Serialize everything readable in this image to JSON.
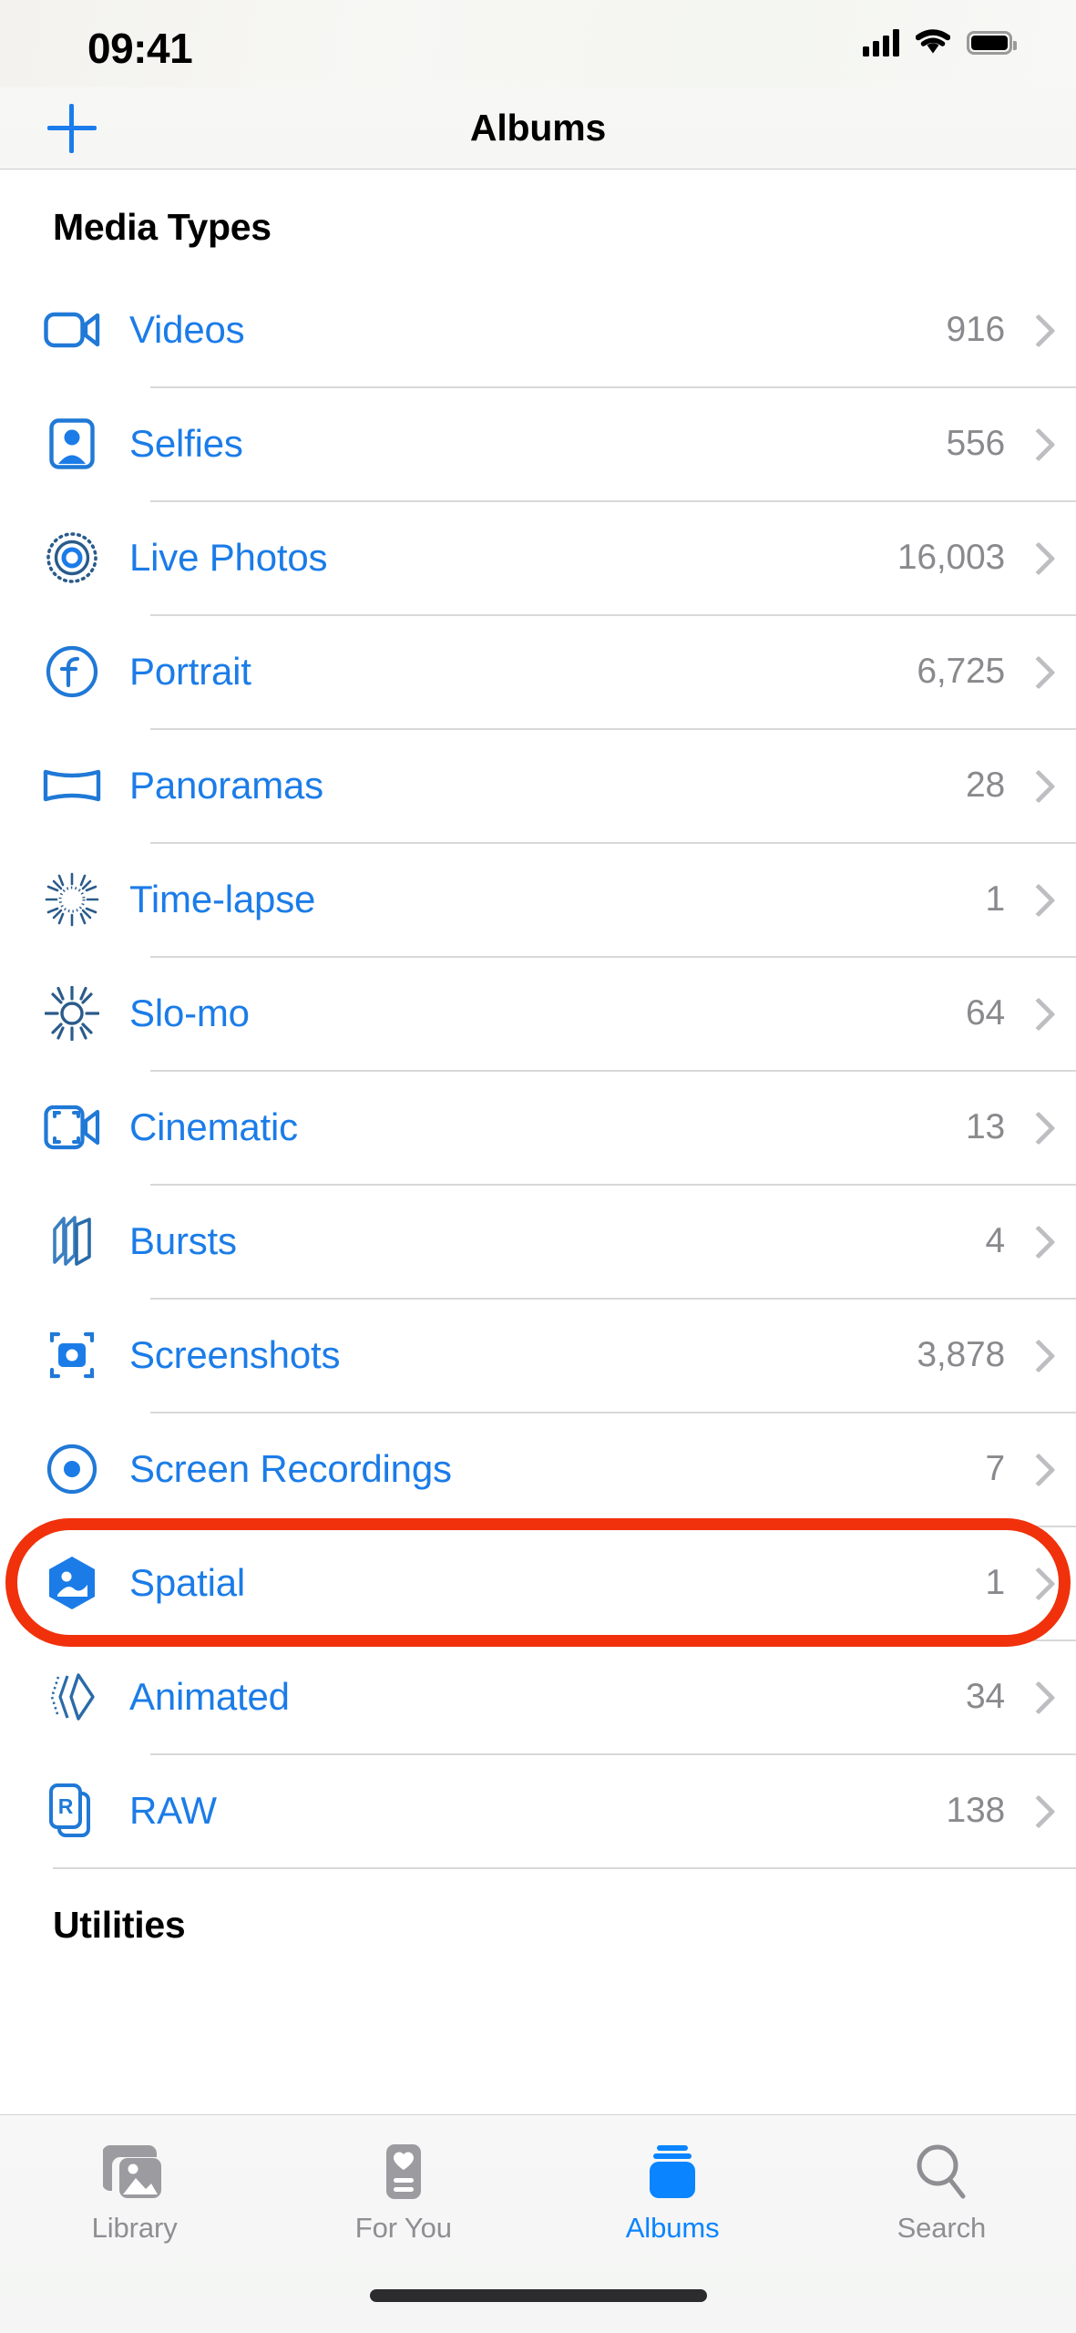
{
  "status_bar": {
    "time": "09:41",
    "icons": [
      "cellular-signal-icon",
      "wifi-icon",
      "battery-icon"
    ]
  },
  "nav_bar": {
    "title": "Albums",
    "add_button": "+",
    "add_icon": "plus-icon"
  },
  "sections": [
    {
      "header": "Media Types",
      "rows": [
        {
          "icon": "video-camera-icon",
          "label": "Videos",
          "count": "916"
        },
        {
          "icon": "person-portrait-icon",
          "label": "Selfies",
          "count": "556"
        },
        {
          "icon": "live-photo-icon",
          "label": "Live Photos",
          "count": "16,003"
        },
        {
          "icon": "f-aperture-icon",
          "label": "Portrait",
          "count": "6,725"
        },
        {
          "icon": "panorama-icon",
          "label": "Panoramas",
          "count": "28"
        },
        {
          "icon": "timelapse-icon",
          "label": "Time-lapse",
          "count": "1"
        },
        {
          "icon": "slomo-icon",
          "label": "Slo-mo",
          "count": "64"
        },
        {
          "icon": "cinematic-icon",
          "label": "Cinematic",
          "count": "13"
        },
        {
          "icon": "bursts-icon",
          "label": "Bursts",
          "count": "4"
        },
        {
          "icon": "screenshot-icon",
          "label": "Screenshots",
          "count": "3,878"
        },
        {
          "icon": "screen-recording-icon",
          "label": "Screen Recordings",
          "count": "7"
        },
        {
          "icon": "spatial-icon",
          "label": "Spatial",
          "count": "1"
        },
        {
          "icon": "animated-icon",
          "label": "Animated",
          "count": "34"
        },
        {
          "icon": "raw-icon",
          "label": "RAW",
          "count": "138"
        }
      ]
    },
    {
      "header": "Utilities",
      "rows": []
    }
  ],
  "annotation": {
    "target_row_label": "Spatial",
    "color": "#F0310C",
    "shape": "rounded-rectangle-highlight"
  },
  "tab_bar": {
    "tabs": [
      {
        "icon": "library-photos-icon",
        "label": "Library",
        "active": false
      },
      {
        "icon": "for-you-card-icon",
        "label": "For You",
        "active": false
      },
      {
        "icon": "albums-stack-icon",
        "label": "Albums",
        "active": true
      },
      {
        "icon": "search-magnifier-icon",
        "label": "Search",
        "active": false
      }
    ]
  },
  "colors": {
    "accent_blue": "#1B7CE8",
    "tab_active_blue": "#0A84FF",
    "count_gray": "#8A8A8E",
    "annotation_red": "#F0310C"
  },
  "home_indicator": "home-indicator-bar"
}
